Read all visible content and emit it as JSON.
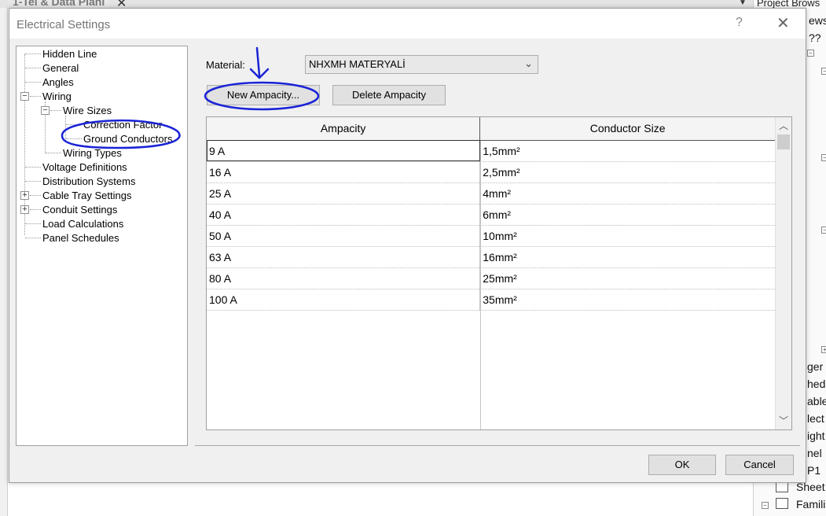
{
  "background": {
    "tab_title": "1-Tel & Data Planı",
    "tab_close": "✕",
    "project_browser_title": "Project Brows",
    "right_fragments": [
      "ews",
      "??",
      "ger",
      "hed",
      "able",
      "lect",
      "ight",
      "nel",
      "P1",
      "Sheet",
      "Famili"
    ]
  },
  "dialog": {
    "title": "Electrical Settings",
    "help": "?",
    "close": "✕"
  },
  "tree": {
    "items": [
      {
        "label": "Hidden Line"
      },
      {
        "label": "General"
      },
      {
        "label": "Angles"
      },
      {
        "label": "Wiring",
        "expander": "−"
      },
      {
        "label": "Wire Sizes",
        "expander": "−"
      },
      {
        "label": "Correction Factor"
      },
      {
        "label": "Ground Conductors",
        "selected": true
      },
      {
        "label": "Wiring Types"
      },
      {
        "label": "Voltage Definitions"
      },
      {
        "label": "Distribution Systems"
      },
      {
        "label": "Cable Tray Settings",
        "expander": "+"
      },
      {
        "label": "Conduit Settings",
        "expander": "+"
      },
      {
        "label": "Load Calculations"
      },
      {
        "label": "Panel Schedules"
      }
    ]
  },
  "material": {
    "label": "Material:",
    "value": "NHXMH MATERYALİ"
  },
  "buttons": {
    "new_ampacity": "New Ampacity...",
    "delete_ampacity": "Delete Ampacity",
    "ok": "OK",
    "cancel": "Cancel"
  },
  "table": {
    "columns": [
      "Ampacity",
      "Conductor Size"
    ],
    "rows": [
      [
        "9 A",
        "1,5mm²"
      ],
      [
        "16 A",
        "2,5mm²"
      ],
      [
        "25 A",
        "4mm²"
      ],
      [
        "40 A",
        "6mm²"
      ],
      [
        "50 A",
        "10mm²"
      ],
      [
        "63 A",
        "16mm²"
      ],
      [
        "80 A",
        "25mm²"
      ],
      [
        "100 A",
        "35mm²"
      ]
    ]
  },
  "colors": {
    "annotation": "#1a23d6",
    "dialog_bg": "#f0f0f0",
    "button_bg": "#e1e1e1"
  }
}
